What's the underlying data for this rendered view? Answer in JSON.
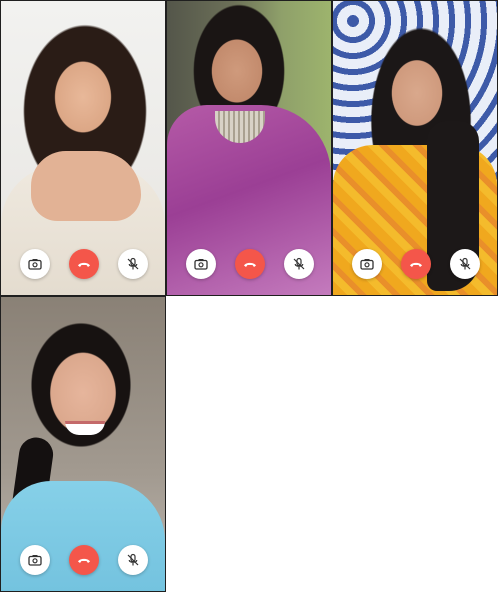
{
  "call": {
    "participants": [
      {
        "id": "p1",
        "controls": [
          "camera-switch",
          "end-call",
          "mute-mic"
        ]
      },
      {
        "id": "p2",
        "controls": [
          "camera-switch",
          "end-call",
          "mute-mic"
        ]
      },
      {
        "id": "p3",
        "controls": [
          "camera-switch",
          "end-call",
          "mute-mic"
        ]
      },
      {
        "id": "p4",
        "controls": [
          "camera-switch",
          "end-call",
          "mute-mic"
        ]
      }
    ],
    "colors": {
      "end_call": "#f4564a",
      "control_bg": "#ffffff",
      "icon": "#333333"
    },
    "icons": {
      "camera": "camera-switch-icon",
      "end": "phone-hangup-icon",
      "mic": "mic-off-icon"
    }
  }
}
